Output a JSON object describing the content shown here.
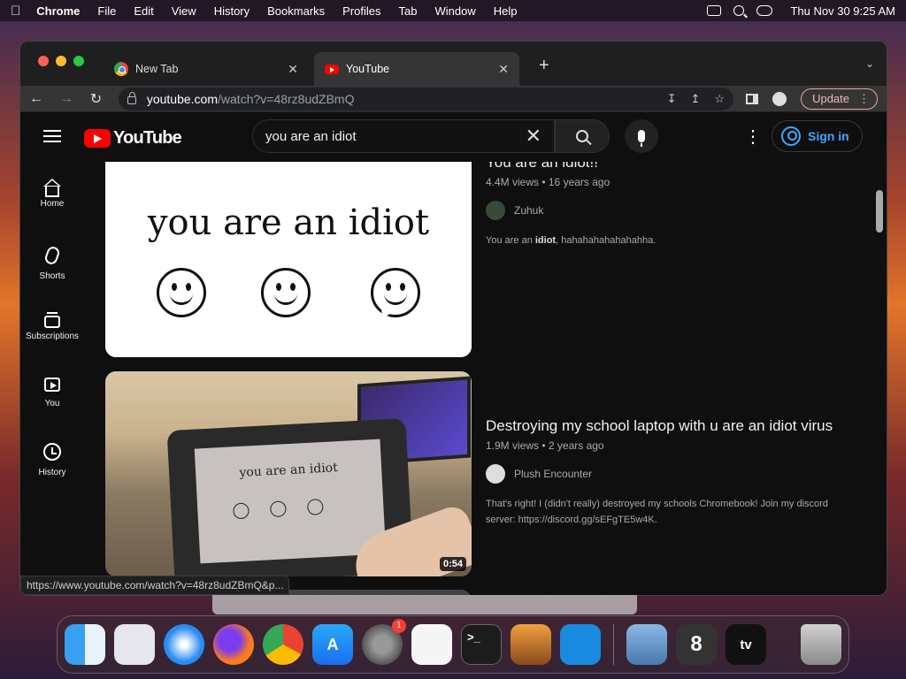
{
  "menubar": {
    "apple": "",
    "app": "Chrome",
    "items": [
      "File",
      "Edit",
      "View",
      "History",
      "Bookmarks",
      "Profiles",
      "Tab",
      "Window",
      "Help"
    ],
    "clock": "Thu Nov 30  9:25 AM"
  },
  "tabs": [
    {
      "title": "New Tab",
      "close": "✕"
    },
    {
      "title": "YouTube",
      "close": "✕"
    }
  ],
  "newtab": "+",
  "toolbar": {
    "back": "←",
    "forward": "→",
    "reload": "↻",
    "url_host": "youtube.com",
    "url_path": "/watch?v=48rz8udZBmQ",
    "update_label": "Update"
  },
  "youtube": {
    "logo_word": "YouTube",
    "search_value": "you are an idiot",
    "clear": "✕",
    "more": "⋮",
    "sign_in": "Sign in",
    "sidebar": [
      {
        "label": "Home"
      },
      {
        "label": "Shorts"
      },
      {
        "label": "Subscriptions"
      },
      {
        "label": "You"
      },
      {
        "label": "History"
      }
    ],
    "videos": [
      {
        "title": "You are an idiot!!",
        "meta": "4.4M views • 16 years ago",
        "channel": "Zuhuk",
        "desc_pre": "You are an ",
        "desc_bold": "idiot",
        "desc_post": ", hahahahahahahahha.",
        "thumb_text": "you are an idiot"
      },
      {
        "title": "Destroying my school laptop with u are an idiot virus",
        "meta": "1.9M views • 2 years ago",
        "channel": "Plush Encounter",
        "desc": "That's right! I (didn't really) destroyed my schools Chromebook! Join my discord server: https://discord.gg/sEFgTE5w4K.",
        "thumb_text": "you are an idiot",
        "duration": "0:54"
      }
    ]
  },
  "status_url": "https://www.youtube.com/watch?v=48rz8udZBmQ&p...",
  "dock": {
    "apps": [
      "finder-icon",
      "launchpad-icon",
      "safari-icon",
      "firefox-icon",
      "chrome-icon",
      "app-store-icon",
      "system-settings-icon",
      "textedit-icon",
      "terminal-icon",
      "garageband-icon",
      "vscode-icon",
      "preview-icon",
      "app-8-icon",
      "apple-tv-icon",
      "trash-icon"
    ],
    "settings_badge": "1",
    "terminal_glyph": ">_",
    "app8_glyph": "8",
    "tv_label": "tv"
  }
}
